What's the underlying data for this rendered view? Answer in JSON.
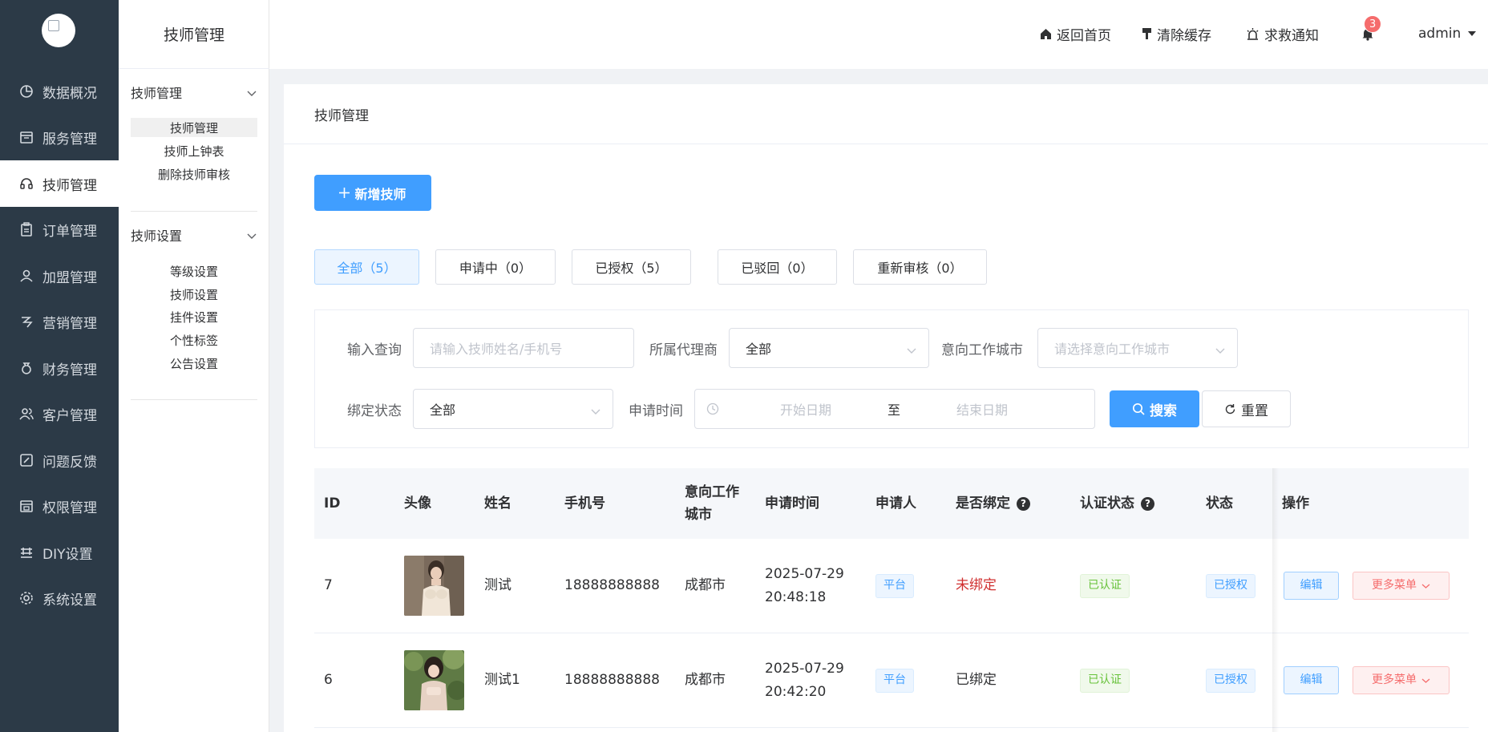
{
  "sidebar": {
    "items": [
      {
        "label": "数据概况",
        "icon": "pie-chart-icon"
      },
      {
        "label": "服务管理",
        "icon": "calendar-icon"
      },
      {
        "label": "技师管理",
        "icon": "headset-icon"
      },
      {
        "label": "订单管理",
        "icon": "clipboard-icon"
      },
      {
        "label": "加盟管理",
        "icon": "user-group-icon"
      },
      {
        "label": "营销管理",
        "icon": "marketing-icon"
      },
      {
        "label": "财务管理",
        "icon": "money-bag-icon"
      },
      {
        "label": "客户管理",
        "icon": "customers-icon"
      },
      {
        "label": "问题反馈",
        "icon": "feedback-icon"
      },
      {
        "label": "权限管理",
        "icon": "permissions-icon"
      },
      {
        "label": "DIY设置",
        "icon": "diy-icon"
      },
      {
        "label": "系统设置",
        "icon": "settings-gear-icon"
      }
    ]
  },
  "subsidebar": {
    "title": "技师管理",
    "group1": {
      "label": "技师管理",
      "items": [
        "技师管理",
        "技师上钟表",
        "删除技师审核"
      ]
    },
    "group2": {
      "label": "技师设置",
      "items": [
        "等级设置",
        "技师设置",
        "挂件设置",
        "个性标签",
        "公告设置"
      ]
    }
  },
  "header": {
    "home": "返回首页",
    "clear_cache": "清除缓存",
    "rescue": "求救通知",
    "badge_count": "3",
    "user": "admin"
  },
  "page": {
    "title": "技师管理",
    "add_button": "新增技师",
    "tabs": [
      "全部（5）",
      "申请中（0）",
      "已授权（5）",
      "已驳回（0）",
      "重新审核（0）"
    ]
  },
  "filters": {
    "query_label": "输入查询",
    "query_placeholder": "请输入技师姓名/手机号",
    "agent_label": "所属代理商",
    "agent_value": "全部",
    "city_label": "意向工作城市",
    "city_placeholder": "请选择意向工作城市",
    "bind_label": "绑定状态",
    "bind_value": "全部",
    "time_label": "申请时间",
    "start_placeholder": "开始日期",
    "range_sep": "至",
    "end_placeholder": "结束日期",
    "search_button": "搜索",
    "reset_button": "重置"
  },
  "table": {
    "headers": {
      "id": "ID",
      "avatar": "头像",
      "name": "姓名",
      "phone": "手机号",
      "city": "意向工作城市",
      "time": "申请时间",
      "applicant": "申请人",
      "bound": "是否绑定",
      "cert": "认证状态",
      "status": "状态",
      "ops": "操作"
    },
    "rows": [
      {
        "id": "7",
        "name": "测试",
        "phone": "18888888888",
        "city": "成都市",
        "date": "2025-07-29",
        "time": "20:48:18",
        "applicant": "平台",
        "bound": "未绑定",
        "cert": "已认证",
        "status": "已授权",
        "edit": "编辑",
        "more": "更多菜单"
      },
      {
        "id": "6",
        "name": "测试1",
        "phone": "18888888888",
        "city": "成都市",
        "date": "2025-07-29",
        "time": "20:42:20",
        "applicant": "平台",
        "bound": "已绑定",
        "cert": "已认证",
        "status": "已授权",
        "edit": "编辑",
        "more": "更多菜单"
      }
    ]
  },
  "colors": {
    "sidebar_bg": "#2c3a47",
    "primary": "#409eff",
    "danger": "#f56c6c",
    "success": "#67c23a"
  }
}
